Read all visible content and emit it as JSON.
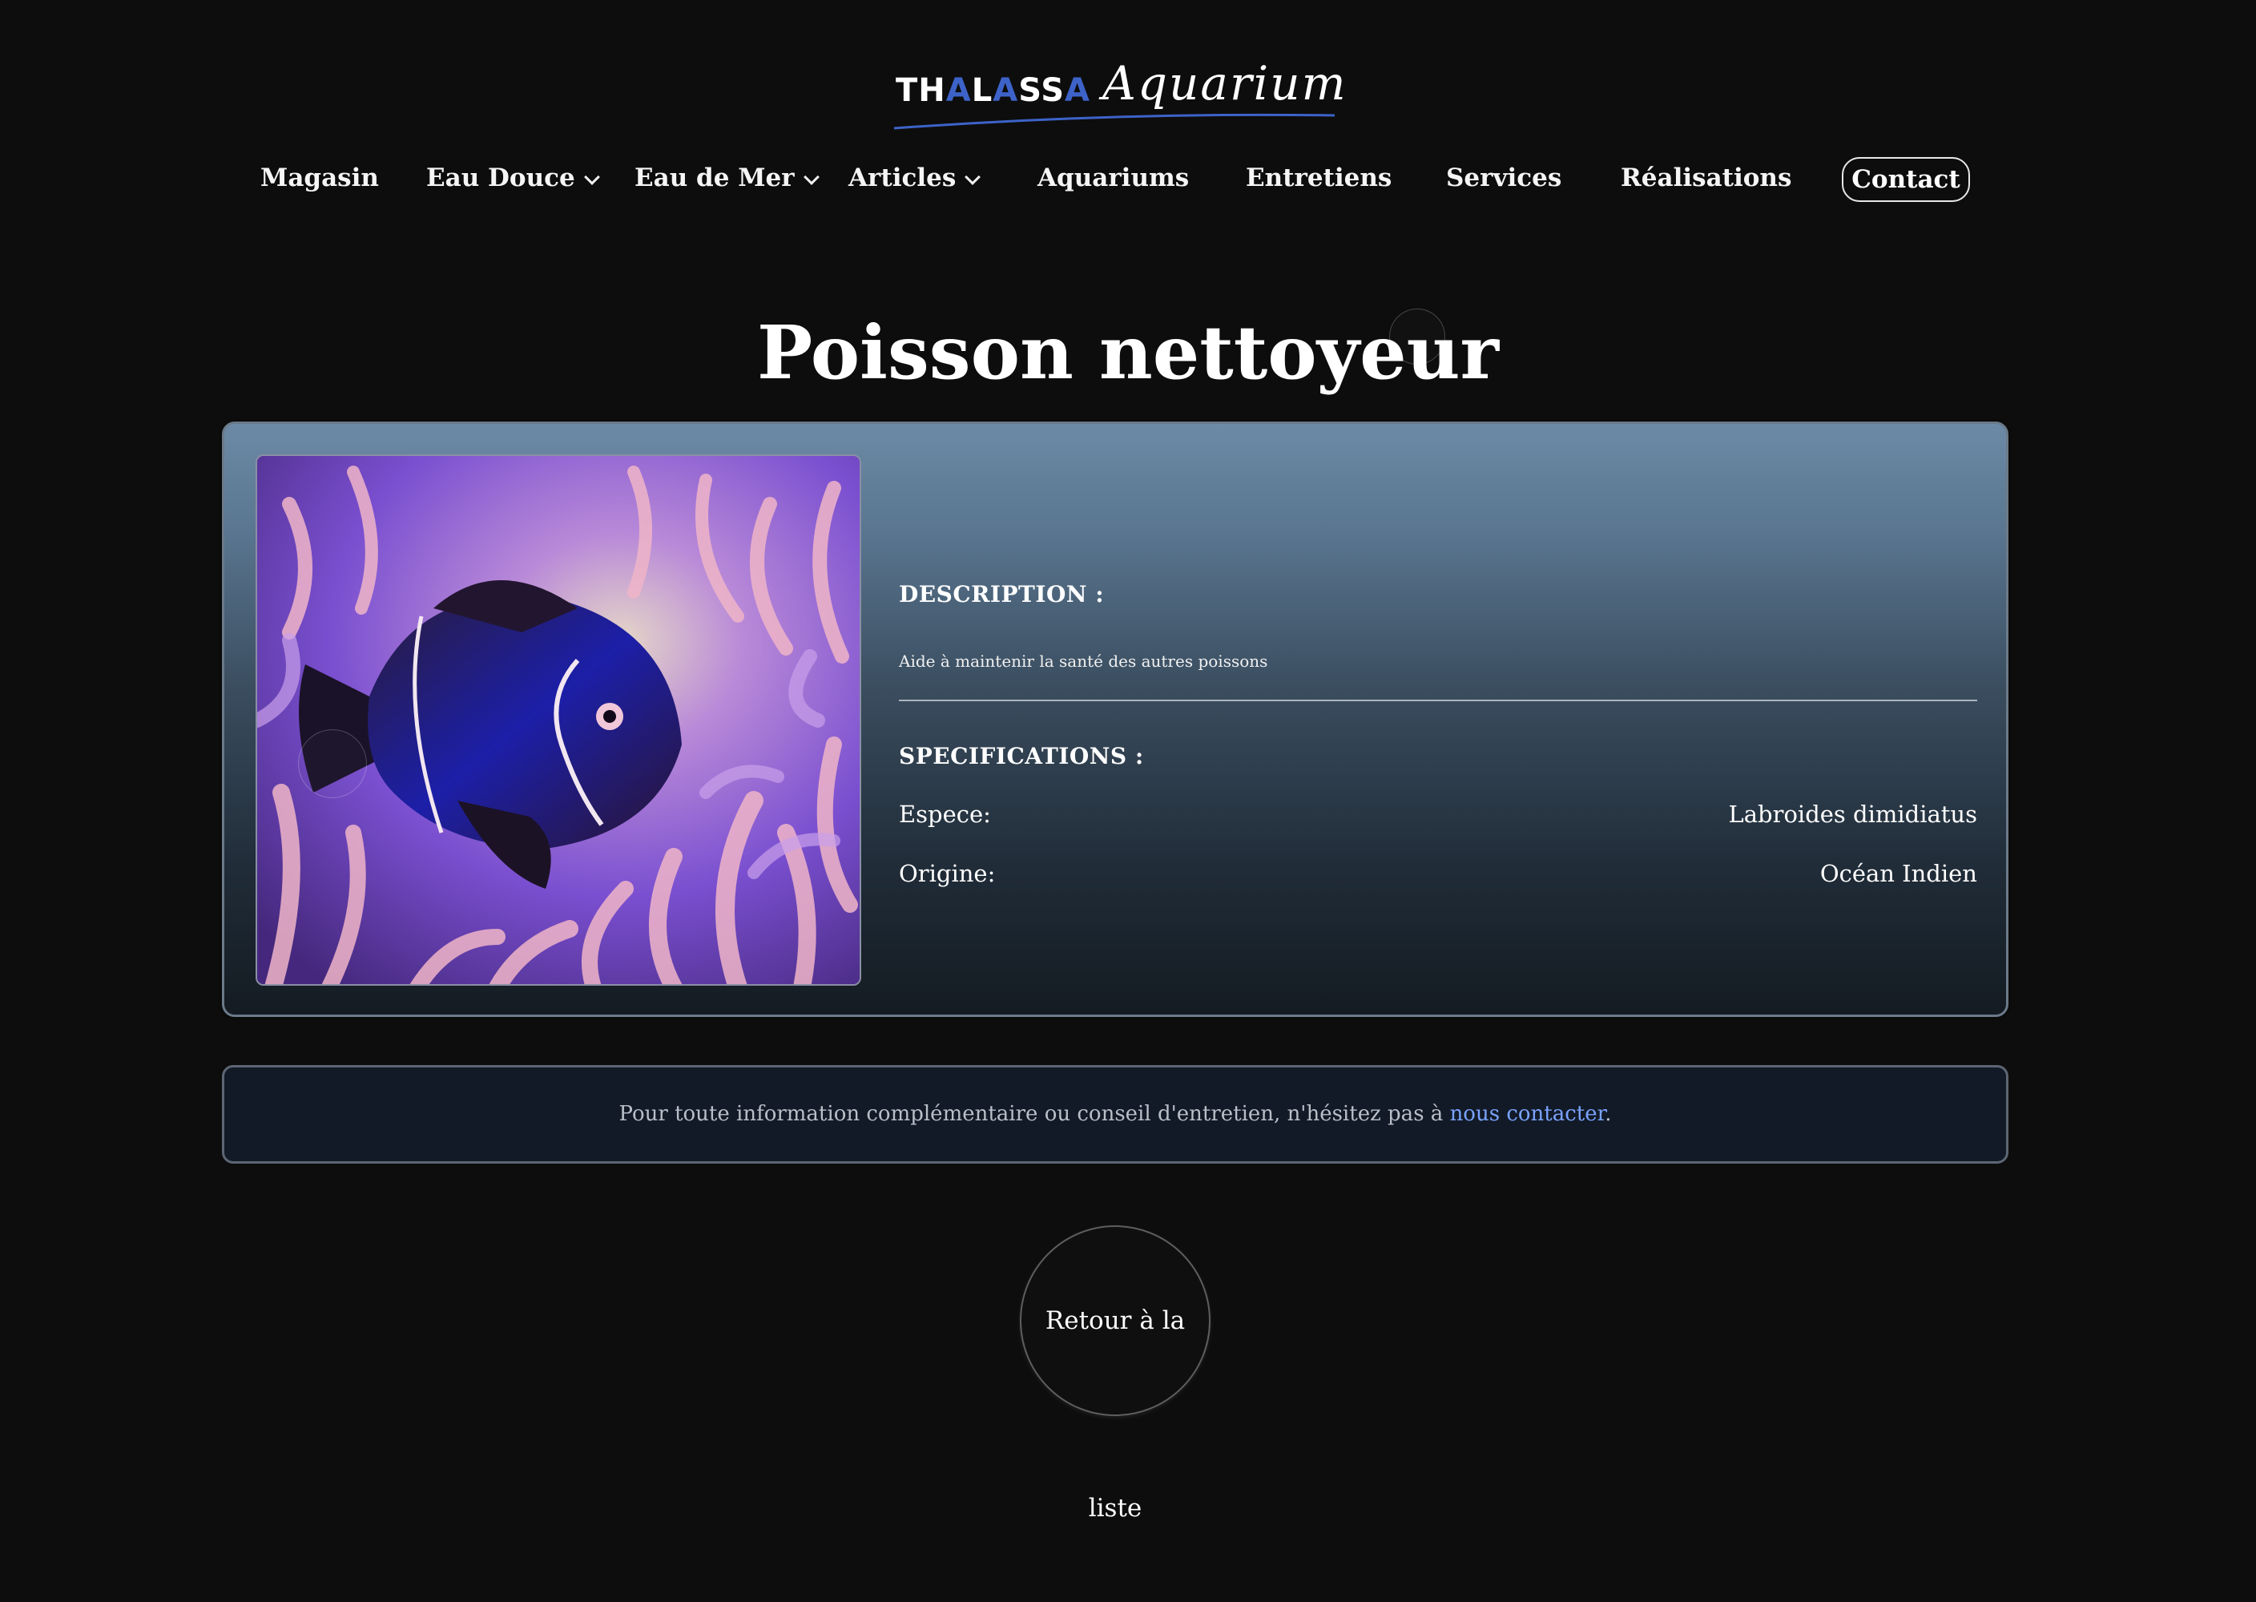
{
  "logo": {
    "brand_parts": [
      "TH",
      "A",
      "L",
      "A",
      "SS",
      "A"
    ],
    "script": "Aquarium",
    "accent_color": "#3d63c9"
  },
  "nav": {
    "items": [
      {
        "label": "Magasin",
        "has_dropdown": false
      },
      {
        "label": "Eau Douce",
        "has_dropdown": true
      },
      {
        "label": "Eau de Mer",
        "has_dropdown": true
      },
      {
        "label": "Articles",
        "has_dropdown": true
      },
      {
        "label": "Aquariums",
        "has_dropdown": false
      },
      {
        "label": "Entretiens",
        "has_dropdown": false
      },
      {
        "label": "Services",
        "has_dropdown": false
      },
      {
        "label": "Réalisations",
        "has_dropdown": false
      }
    ],
    "contact_label": "Contact"
  },
  "page": {
    "title": "Poisson nettoyeur"
  },
  "product": {
    "image_icon": "fish-photo",
    "description_heading": "DESCRIPTION :",
    "description": "Aide à maintenir la santé des autres poissons",
    "specifications_heading": "SPECIFICATIONS :",
    "specs": [
      {
        "label": "Espece:",
        "value": "Labroides dimidiatus"
      },
      {
        "label": "Origine:",
        "value": "Océan Indien"
      }
    ]
  },
  "info": {
    "text": "Pour toute information complémentaire ou conseil d'entretien, n'hésitez pas à ",
    "link_label": "nous contacter",
    "suffix": ".",
    "link_color": "#7aa3ff"
  },
  "back_button": {
    "label": "Retour à la liste"
  }
}
